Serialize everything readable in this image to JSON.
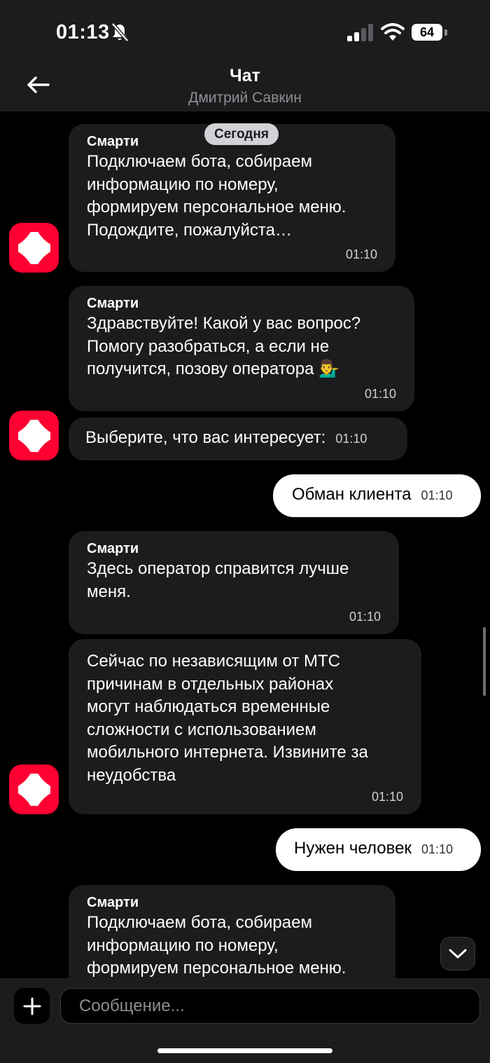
{
  "status_bar": {
    "time": "01:13",
    "battery": "64"
  },
  "header": {
    "title": "Чат",
    "subtitle": "Дмитрий Савкин"
  },
  "chat": {
    "date_label": "Сегодня",
    "messages": [
      {
        "sender": "Смарти",
        "text": "Подключаем бота, собираем\nинформацию по номеру,\nформируем персональное меню.\nПодождите, пожалуйста…",
        "time": "01:10"
      },
      {
        "sender": "Смарти",
        "text": "Здравствуйте! Какой у вас вопрос?\nПомогу разобраться, а если не\nполучится, позову оператора 💁‍♂️",
        "time": "01:10"
      },
      {
        "text": "Выберите, что вас интересует:",
        "time": "01:10"
      },
      {
        "text": "Обман клиента",
        "time": "01:10"
      },
      {
        "sender": "Смарти",
        "text": "Здесь оператор справится лучше\nменя.",
        "time": "01:10"
      },
      {
        "text": "Сейчас по независящим от МТС\nпричинам в отдельных районах\nмогут наблюдаться временные\nсложности с использованием\nмобильного интернета. Извините за\nнеудобства",
        "time": "01:10"
      },
      {
        "text": "Нужен человек",
        "time": "01:10"
      },
      {
        "sender": "Смарти",
        "text": "Подключаем бота, собираем\nинформацию по номеру,\nформируем персональное меню."
      }
    ]
  },
  "composer": {
    "placeholder": "Сообщение..."
  },
  "colors": {
    "accent": "#ff0032",
    "bubble_bot": "#1c1c1e",
    "bubble_user": "#ffffff",
    "background": "#000000"
  },
  "icons": [
    "bell-slash-icon",
    "signal-icon",
    "wifi-icon",
    "battery-icon",
    "back-arrow-icon",
    "bot-avatar-icon",
    "chevron-down-icon",
    "plus-icon"
  ]
}
